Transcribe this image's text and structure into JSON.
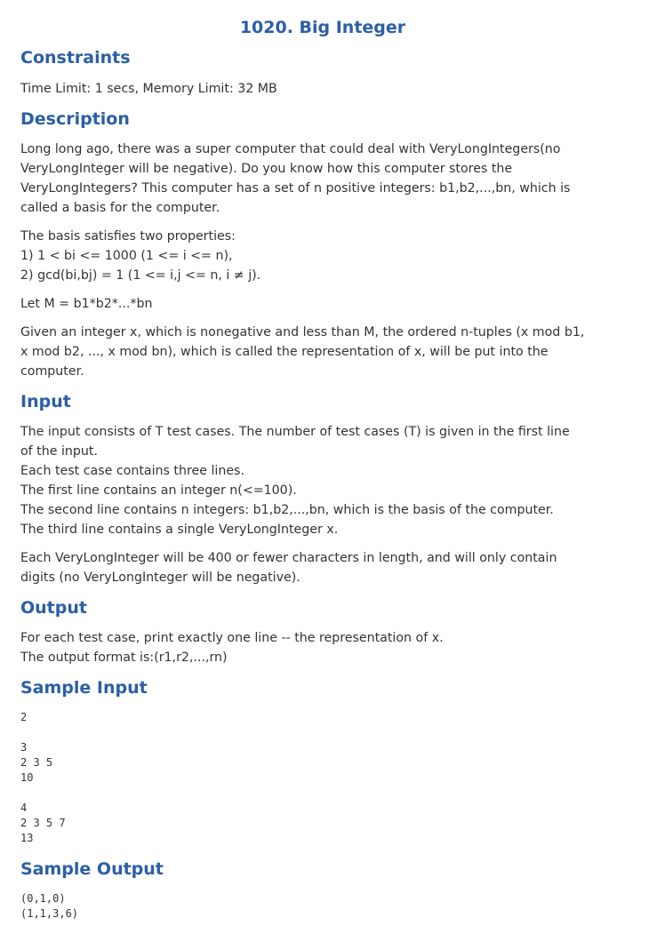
{
  "title": "1020. Big Integer",
  "sections": {
    "constraints": {
      "heading": "Constraints",
      "text": "Time Limit: 1 secs, Memory Limit: 32 MB"
    },
    "description": {
      "heading": "Description",
      "p1": [
        "Long long ago, there was a super computer that could deal with VeryLongIntegers(no",
        "VeryLongInteger will be negative). Do you know how this computer stores the",
        "VeryLongIntegers? This computer has a set of n positive integers: b1,b2,...,bn, which is",
        "called a basis for the computer."
      ],
      "p2": [
        "The basis satisfies two properties:",
        "1) 1 < bi <= 1000 (1 <= i <= n),",
        "2) gcd(bi,bj) = 1 (1 <= i,j <= n, i ≠ j)."
      ],
      "p3": "Let M = b1*b2*...*bn",
      "p4": [
        "Given an integer x, which is nonegative and less than M, the ordered n-tuples (x mod b1,",
        "x mod b2, ..., x mod bn), which is called the representation of x, will be put into the",
        "computer."
      ]
    },
    "input": {
      "heading": "Input",
      "p1": [
        "The input consists of T test cases. The number of test cases (T) is given in the first line",
        "of the input.",
        "Each test case contains three lines.",
        "The first line contains an integer n(<=100).",
        "The second line contains n integers: b1,b2,...,bn, which is the basis of the computer.",
        "The third line contains a single VeryLongInteger x."
      ],
      "p2": [
        "Each VeryLongInteger will be 400 or fewer characters in length, and will only contain",
        "digits (no VeryLongInteger will be negative)."
      ]
    },
    "output": {
      "heading": "Output",
      "p1": [
        "For each test case, print exactly one line -- the representation of x.",
        "The output format is:(r1,r2,...,rn)"
      ]
    },
    "sample_input": {
      "heading": "Sample Input",
      "lines": [
        "2",
        "",
        "3",
        "2 3 5",
        "10",
        "",
        "4",
        "2 3 5 7",
        "13"
      ]
    },
    "sample_output": {
      "heading": "Sample Output",
      "lines": [
        "(0,1,0)",
        "(1,1,3,6)"
      ]
    }
  }
}
